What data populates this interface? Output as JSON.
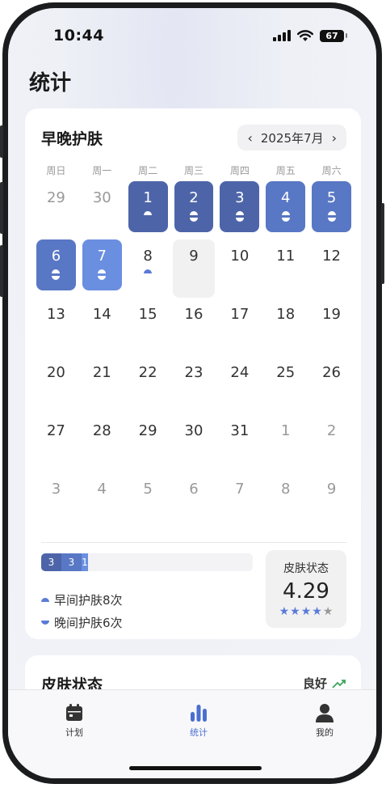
{
  "status_bar": {
    "time": "10:44",
    "battery": "67"
  },
  "page_title": "统计",
  "calendar": {
    "title": "早晚护肤",
    "month": "2025年7月",
    "prev_icon": "chevron-left-icon",
    "next_icon": "chevron-right-icon",
    "weekdays": [
      "周日",
      "周一",
      "周二",
      "周三",
      "周四",
      "周五",
      "周六"
    ],
    "weeks": [
      [
        {
          "n": "29",
          "muted": true
        },
        {
          "n": "30",
          "muted": true
        },
        {
          "n": "1",
          "fill": "#4d65a8",
          "am": true,
          "pm": false
        },
        {
          "n": "2",
          "fill": "#4d65a8",
          "am": true,
          "pm": true
        },
        {
          "n": "3",
          "fill": "#4d65a8",
          "am": true,
          "pm": true
        },
        {
          "n": "4",
          "fill": "#5877c4",
          "am": true,
          "pm": true
        },
        {
          "n": "5",
          "fill": "#5877c4",
          "am": true,
          "pm": true
        }
      ],
      [
        {
          "n": "6",
          "fill": "#5877c4",
          "am": true,
          "pm": true
        },
        {
          "n": "7",
          "fill": "#6a8ee0",
          "am": true,
          "pm": true
        },
        {
          "n": "8",
          "am": true,
          "pm": false
        },
        {
          "n": "9",
          "today": true
        },
        {
          "n": "10"
        },
        {
          "n": "11"
        },
        {
          "n": "12"
        }
      ],
      [
        {
          "n": "13"
        },
        {
          "n": "14"
        },
        {
          "n": "15"
        },
        {
          "n": "16"
        },
        {
          "n": "17"
        },
        {
          "n": "18"
        },
        {
          "n": "19"
        }
      ],
      [
        {
          "n": "20"
        },
        {
          "n": "21"
        },
        {
          "n": "22"
        },
        {
          "n": "23"
        },
        {
          "n": "24"
        },
        {
          "n": "25"
        },
        {
          "n": "26"
        }
      ],
      [
        {
          "n": "27"
        },
        {
          "n": "28"
        },
        {
          "n": "29"
        },
        {
          "n": "30"
        },
        {
          "n": "31"
        },
        {
          "n": "1",
          "muted": true
        },
        {
          "n": "2",
          "muted": true
        }
      ],
      [
        {
          "n": "3",
          "muted": true
        },
        {
          "n": "4",
          "muted": true
        },
        {
          "n": "5",
          "muted": true
        },
        {
          "n": "6",
          "muted": true
        },
        {
          "n": "7",
          "muted": true
        },
        {
          "n": "8",
          "muted": true
        },
        {
          "n": "9",
          "muted": true
        }
      ]
    ],
    "progress_segments": [
      {
        "label": "3",
        "value": 3,
        "color": "#4d65a8"
      },
      {
        "label": "3",
        "value": 3,
        "color": "#5877c4"
      },
      {
        "label": "1",
        "value": 1,
        "color": "#6a8ee0"
      }
    ],
    "progress_total_days": 31,
    "legend": {
      "morning": "早间护肤8次",
      "evening": "晚间护肤6次"
    },
    "skin": {
      "label": "皮肤状态",
      "score": "4.29",
      "stars_filled": 4,
      "stars_total": 5
    }
  },
  "skin_card": {
    "title": "皮肤状态",
    "status": "良好",
    "trend_icon": "trend-up-icon"
  },
  "tabs": [
    {
      "label": "计划",
      "icon": "calendar-icon",
      "active": false
    },
    {
      "label": "统计",
      "icon": "bar-chart-icon",
      "active": true
    },
    {
      "label": "我的",
      "icon": "user-icon",
      "active": false
    }
  ],
  "colors": {
    "accent": "#4a6fd1",
    "star": "#5b7bd6",
    "star_empty": "#999999",
    "trend": "#3aa55a"
  }
}
